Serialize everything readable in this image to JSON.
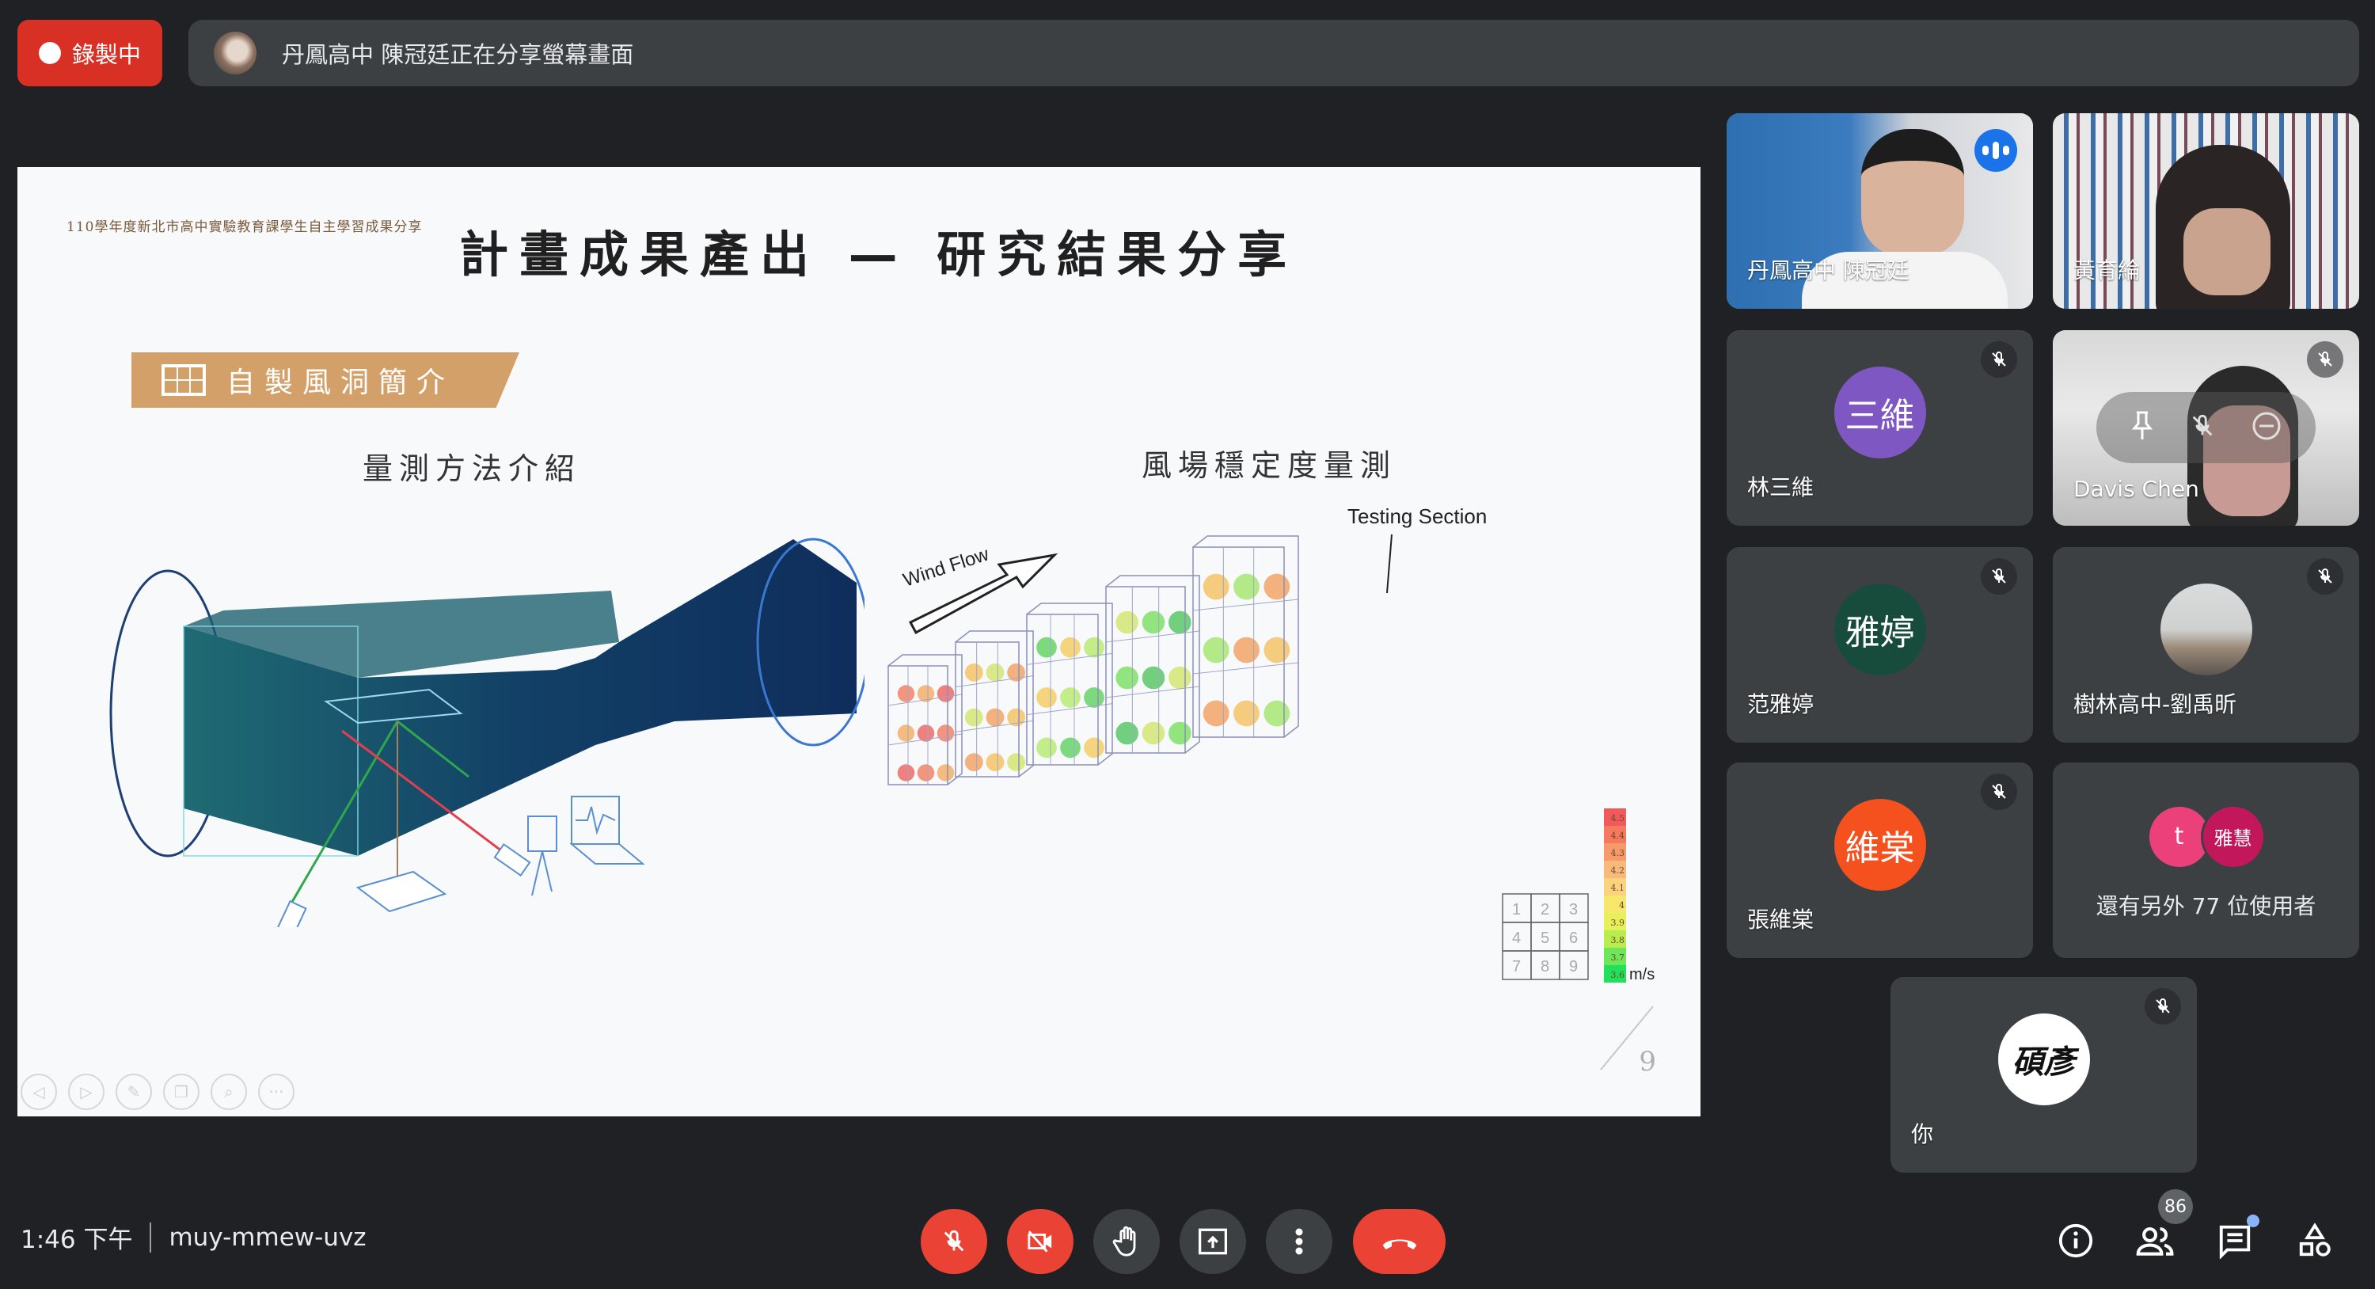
{
  "top_bar": {
    "recording_label": "錄製中",
    "presenting_banner": "丹鳳高中 陳冠廷正在分享螢幕畫面"
  },
  "slide": {
    "header_note": "110學年度新北市高中實驗教育課學生自主學習成果分享",
    "title": "計畫成果產出 — 研究結果分享",
    "section_tag": "自製風洞簡介",
    "left_subtitle": "量測方法介紹",
    "right_subtitle": "風場穩定度量測",
    "wind_flow_label": "Wind Flow",
    "testing_section_label": "Testing Section",
    "grid_numbers": [
      "1",
      "2",
      "3",
      "4",
      "5",
      "6",
      "7",
      "8",
      "9"
    ],
    "legend": {
      "unit": "m/s",
      "values": [
        "4.5",
        "4.4",
        "4.3",
        "4.2",
        "4.1",
        "4",
        "3.9",
        "3.8",
        "3.7",
        "3.6"
      ],
      "colors": [
        "#f05a5a",
        "#f5785f",
        "#f79a6b",
        "#f9b97a",
        "#fbd27d",
        "#f7e86b",
        "#e6f05a",
        "#b9ec4d",
        "#6ee65a",
        "#22e05a"
      ]
    },
    "page_number": "9",
    "controls": [
      "previous",
      "next",
      "pen",
      "slides",
      "zoom",
      "more"
    ]
  },
  "participants": [
    {
      "name": "丹鳳高中 陳冠廷",
      "type": "video",
      "speaking": true,
      "muted": false
    },
    {
      "name": "黃育綸",
      "type": "video",
      "muted": false
    },
    {
      "name": "林三維",
      "type": "avatar",
      "initials": "三維",
      "color": "#7e57c2",
      "muted": true
    },
    {
      "name": "Davis Chen",
      "type": "video",
      "muted": true,
      "hover_actions": [
        "pin",
        "mute",
        "remove"
      ]
    },
    {
      "name": "范雅婷",
      "type": "avatar",
      "initials": "雅婷",
      "color": "#174c3c",
      "muted": true
    },
    {
      "name": "樹林高中-劉禹昕",
      "type": "photo",
      "muted": true
    },
    {
      "name": "張維棠",
      "type": "avatar",
      "initials": "維棠",
      "color": "#f4511e",
      "muted": true
    },
    {
      "name": "你",
      "type": "photo",
      "initials": "碩彥",
      "muted": true
    }
  ],
  "others": {
    "avatars": [
      {
        "initials": "t",
        "color": "#ec407a"
      },
      {
        "initials": "雅慧",
        "color": "#c2185b"
      }
    ],
    "label": "還有另外 77 位使用者"
  },
  "bottom_bar": {
    "time": "1:46 下午",
    "meeting_code": "muy-mmew-uvz",
    "participant_count": "86",
    "chat_unread": true,
    "controls": [
      "mic-off",
      "camera-off",
      "raise-hand",
      "present",
      "more-options",
      "leave-call"
    ],
    "right_controls": [
      "meeting-details",
      "people",
      "chat",
      "activities"
    ]
  }
}
